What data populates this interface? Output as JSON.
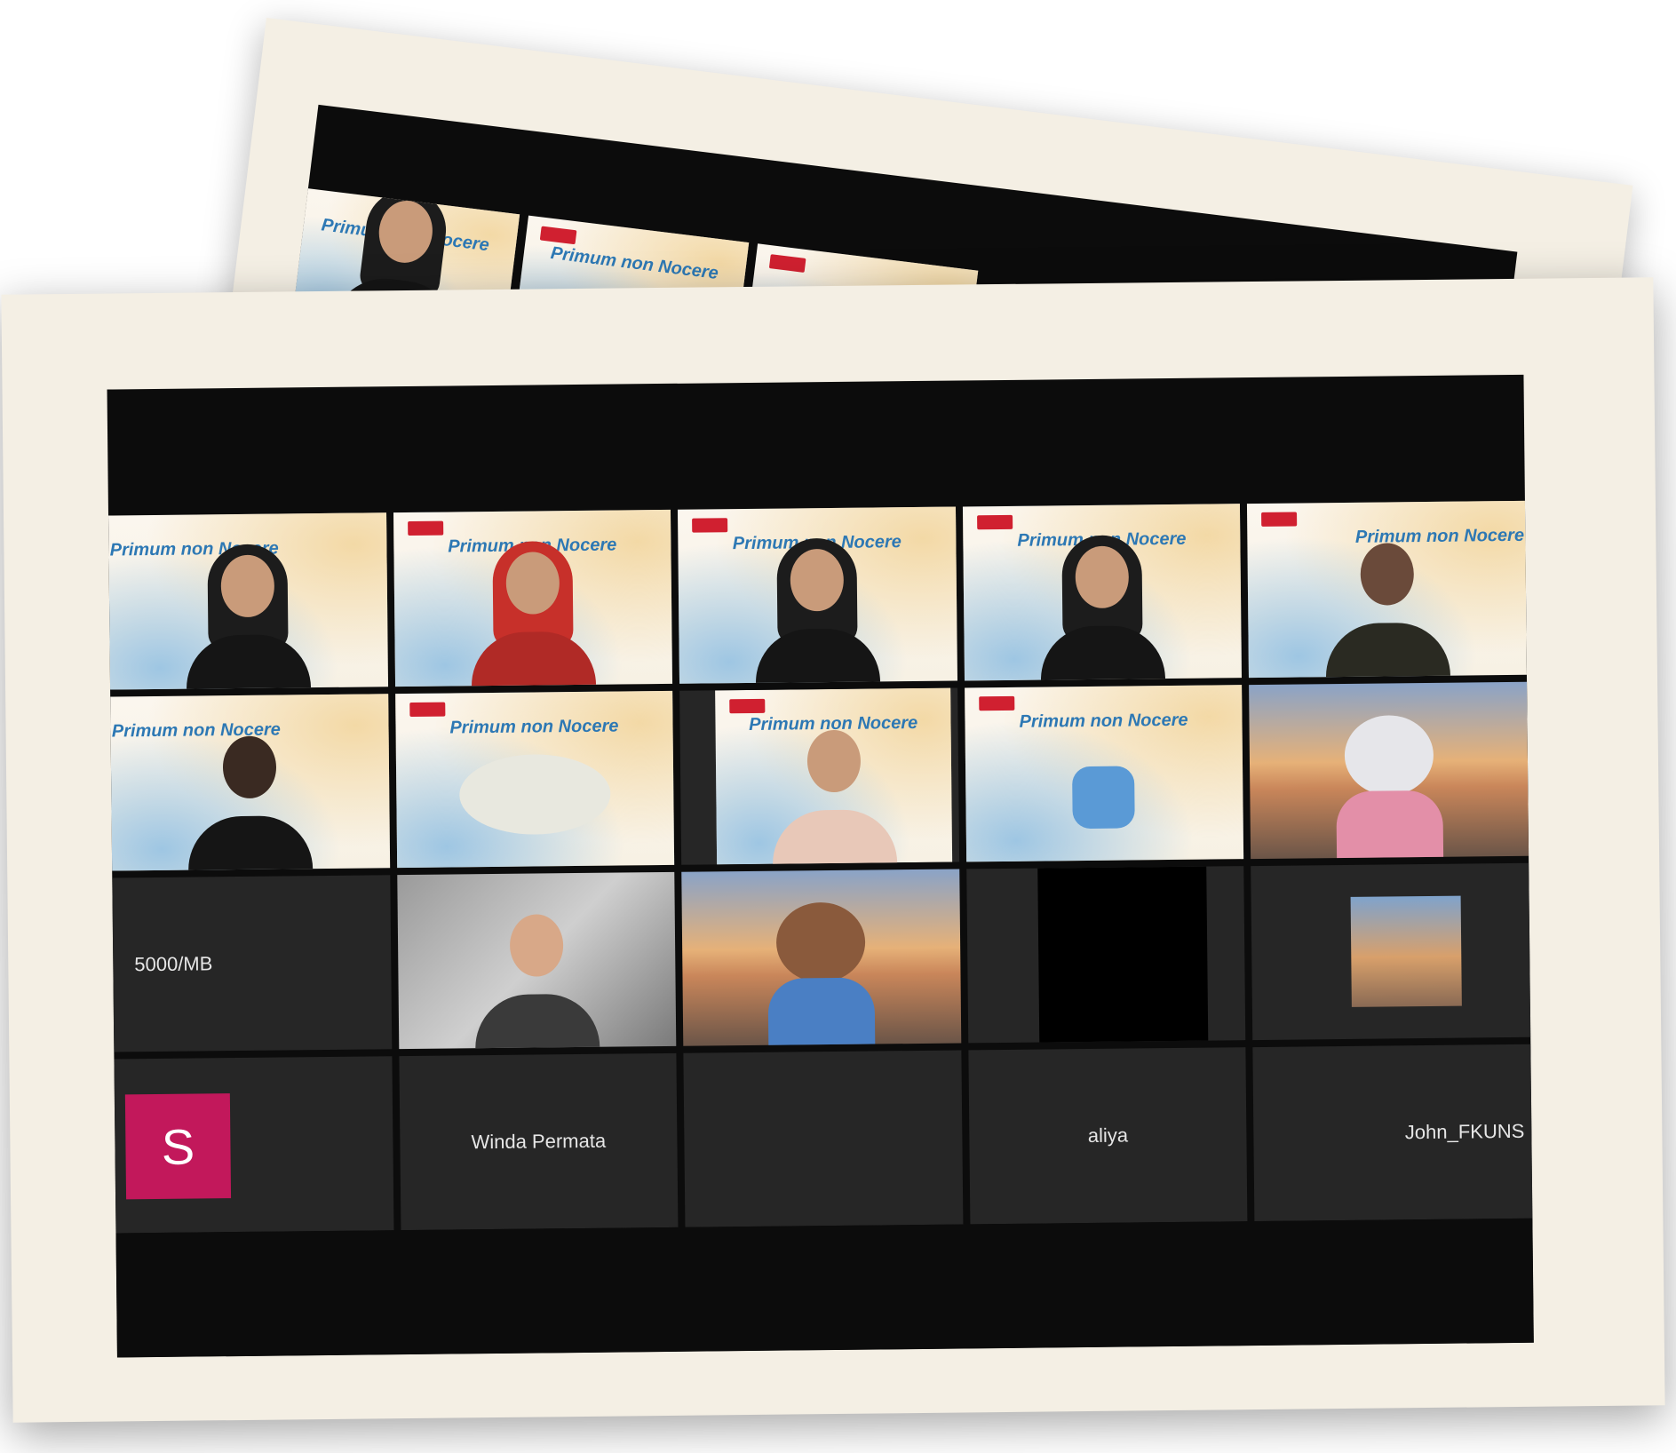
{
  "slide": {
    "title": "Primum non Nocere"
  },
  "row1": [
    {
      "kind": "slide"
    },
    {
      "kind": "slide",
      "red": true
    },
    {
      "kind": "slide"
    },
    {
      "kind": "slide"
    },
    {
      "kind": "slide"
    }
  ],
  "row2": [
    {
      "kind": "slide"
    },
    {
      "kind": "slide-plush"
    },
    {
      "kind": "slide"
    },
    {
      "kind": "slide-glove"
    },
    {
      "kind": "avatar-bg"
    }
  ],
  "row3": {
    "tile1_label": "5000/MB"
  },
  "row4": {
    "avatar_initial": "S",
    "name2": "Winda Permata",
    "name4": "aliya",
    "name5": "John_FKUNS"
  },
  "colors": {
    "screen_bg": "#0c0c0c",
    "tile_bg": "#262626",
    "avatar_pink": "#c2185b",
    "slide_title": "#2d78b4",
    "photo_paper": "#f4efe4"
  }
}
